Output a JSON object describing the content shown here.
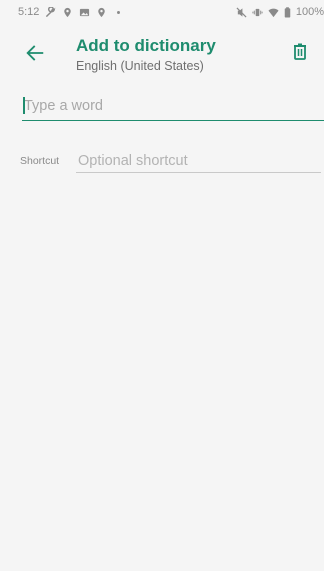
{
  "status_bar": {
    "time": "5:12",
    "left_icons": [
      "wrench-icon",
      "location-pin-icon",
      "image-icon",
      "location-pin-icon",
      "dot-icon"
    ],
    "right_icons": [
      "mute-icon",
      "vibrate-icon",
      "wifi-icon",
      "battery-icon"
    ],
    "battery_text": "100%"
  },
  "app_bar": {
    "title": "Add to dictionary",
    "subtitle": "English (United States)",
    "back_icon": "arrow-back-icon",
    "delete_icon": "trash-icon"
  },
  "form": {
    "word": {
      "value": "",
      "placeholder": "Type a word"
    },
    "shortcut": {
      "label": "Shortcut",
      "value": "",
      "placeholder": "Optional shortcut"
    }
  },
  "colors": {
    "accent": "#1e8c6e",
    "background": "#f5f5f5",
    "secondary_text": "#6f6f6f"
  }
}
